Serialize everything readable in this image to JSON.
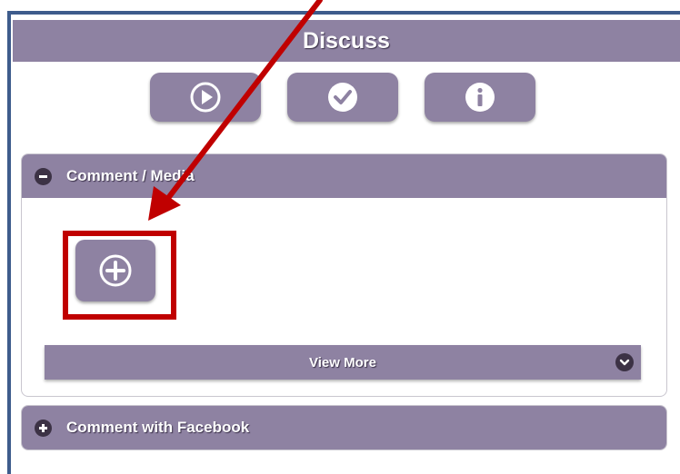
{
  "header": {
    "title": "Discuss"
  },
  "toolbar": {
    "buttons": [
      {
        "icon": "play-circle-icon"
      },
      {
        "icon": "check-circle-icon"
      },
      {
        "icon": "info-circle-icon"
      }
    ]
  },
  "panels": {
    "comment_media": {
      "label": "Comment / Media",
      "expanded": true,
      "add_icon": "plus-circle-icon",
      "view_more_label": "View More"
    },
    "comment_facebook": {
      "label": "Comment with Facebook",
      "expanded": false
    }
  },
  "colors": {
    "accent": "#8e82a2",
    "dark_icon": "#3c3245",
    "annotation_red": "#c00000",
    "frame_blue": "#3e5c8c"
  }
}
